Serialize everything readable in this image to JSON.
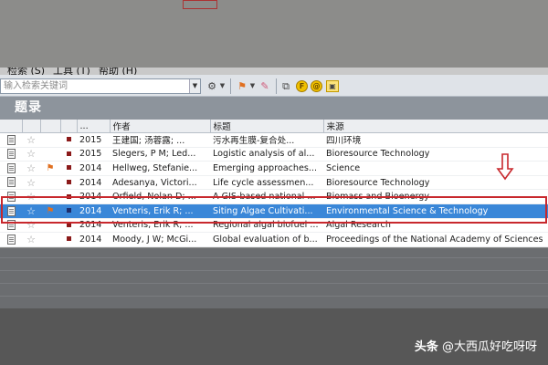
{
  "menu": {
    "items": [
      "检索 (S)",
      "工具 (T)",
      "帮助 (H)"
    ]
  },
  "search": {
    "placeholder": "输入检索关键词"
  },
  "panel": {
    "title": "题录"
  },
  "table": {
    "headers": [
      "",
      "",
      "",
      "",
      "...",
      "作者",
      "标题",
      "来源"
    ],
    "rows": [
      {
        "year": "2015",
        "author": "王建国; 汤蓉露; ...",
        "title": "污水再生膜-复合处...",
        "source": "四川环境",
        "flag": false,
        "selected": false
      },
      {
        "year": "2015",
        "author": "Slegers, P M; Led...",
        "title": "Logistic analysis of al...",
        "source": "Bioresource Technology",
        "flag": false,
        "selected": false
      },
      {
        "year": "2014",
        "author": "Hellweg, Stefanie...",
        "title": "Emerging approaches...",
        "source": "Science",
        "flag": true,
        "selected": false
      },
      {
        "year": "2014",
        "author": "Adesanya, Victori...",
        "title": "Life cycle assessmen...",
        "source": "Bioresource Technology",
        "flag": false,
        "selected": false
      },
      {
        "year": "2014",
        "author": "Orfield, Nolan D; ...",
        "title": "A GIS-based national ...",
        "source": "Biomass and Bioenergy",
        "flag": false,
        "selected": false
      },
      {
        "year": "2014",
        "author": "Venteris, Erik R; ...",
        "title": "Siting Algae Cultivati...",
        "source": "Environmental Science & Technology",
        "flag": true,
        "selected": true
      },
      {
        "year": "2014",
        "author": "Venteris, Erik R; ...",
        "title": "Regional algal biofuel ...",
        "source": "Algal Research",
        "flag": false,
        "selected": false
      },
      {
        "year": "2014",
        "author": "Moody, J W; McGi...",
        "title": "Global evaluation of b...",
        "source": "Proceedings of the National Academy of Sciences",
        "flag": false,
        "selected": false
      }
    ]
  },
  "watermark": {
    "logo": "头条",
    "handle": "@大西瓜好吃呀呀"
  },
  "colors": {
    "selected_row": "#3a87d8",
    "highlight_box": "#c8282d",
    "panel_header": "#8d949c"
  }
}
